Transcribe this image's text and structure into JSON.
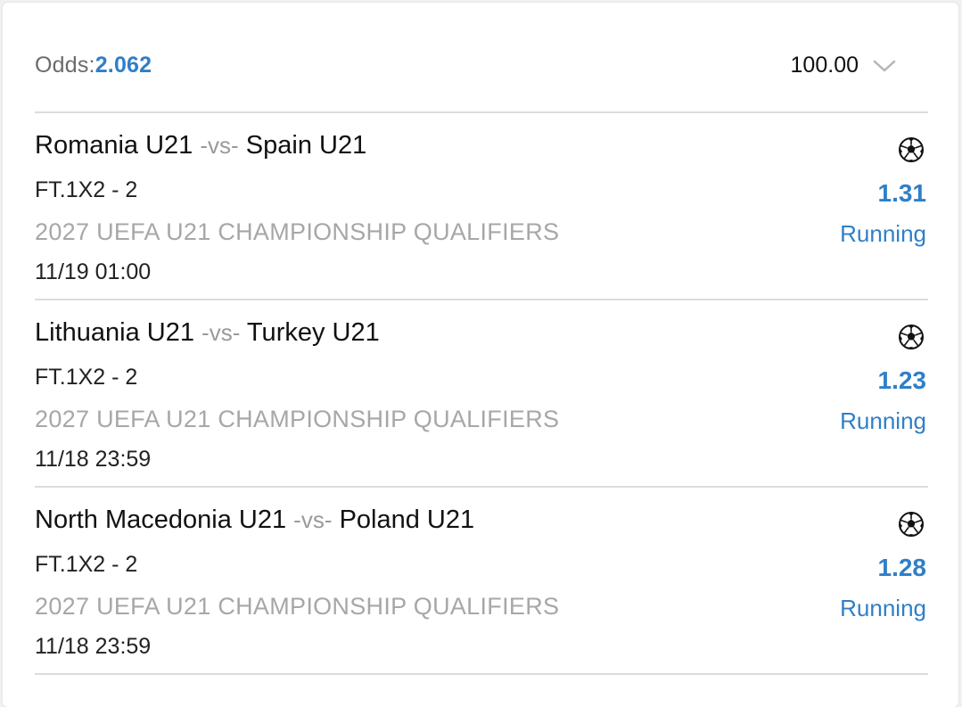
{
  "header": {
    "odds_label": "Odds:",
    "odds_value": "2.062",
    "stake_value": "100.00",
    "dropdown_icon": "chevron-down-icon"
  },
  "bets": [
    {
      "home": "Romania U21",
      "vs": "-vs-",
      "away": "Spain U21",
      "market": "FT.1X2 - 2",
      "league": "2027 UEFA U21 CHAMPIONSHIP QUALIFIERS",
      "time": "11/19 01:00",
      "odds": "1.31",
      "status": "Running",
      "sport_icon": "soccer-ball-icon"
    },
    {
      "home": "Lithuania U21",
      "vs": "-vs-",
      "away": "Turkey U21",
      "market": "FT.1X2 - 2",
      "league": "2027 UEFA U21 CHAMPIONSHIP QUALIFIERS",
      "time": "11/18 23:59",
      "odds": "1.23",
      "status": "Running",
      "sport_icon": "soccer-ball-icon"
    },
    {
      "home": "North Macedonia U21",
      "vs": "-vs-",
      "away": "Poland U21",
      "market": "FT.1X2 - 2",
      "league": "2027 UEFA U21 CHAMPIONSHIP QUALIFIERS",
      "time": "11/18 23:59",
      "odds": "1.28",
      "status": "Running",
      "sport_icon": "soccer-ball-icon"
    }
  ],
  "colors": {
    "accent": "#2f7fc8",
    "muted": "#a7a7a7",
    "divider": "#dcdcdc"
  }
}
